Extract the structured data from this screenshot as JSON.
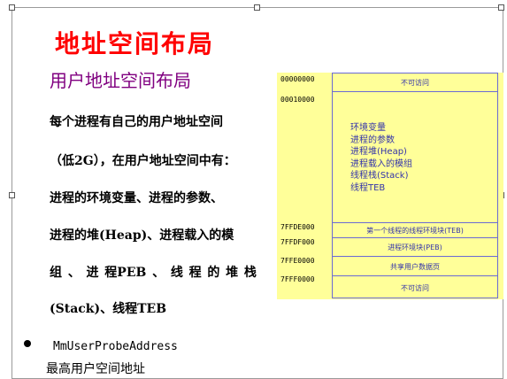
{
  "title": "地址空间布局",
  "subtitle": "用户地址空间布局",
  "body": {
    "line1": "每个进程有自己的用户地址空间",
    "line2": "（低2G），在用户地址空间中有：",
    "line3": "进程的环境变量、进程的参数、",
    "line4": "进程的堆(Heap)、进程载入的模",
    "line5_parts": [
      "组",
      "、",
      "进",
      "程PEB",
      "、",
      "线",
      "程",
      "的",
      "堆",
      "栈"
    ],
    "line6": "(Stack)、线程TEB"
  },
  "bullet": {
    "text": "MmUserProbeAddress",
    "sub": "最高用户空间地址"
  },
  "memory_map": {
    "addresses": [
      "00000000",
      "00010000",
      "7FFDE000",
      "7FFDF000",
      "7FFE0000",
      "7FFF0000"
    ],
    "rows": {
      "no_access_top": "不可访问",
      "first_thread_teb": "第一个线程的线程环境块(TEB)",
      "process_peb": "进程环境块(PEB)",
      "shared_user_data": "共享用户数据页",
      "no_access_bottom": "不可访问"
    },
    "user_region_items": [
      "环境变量",
      "进程的参数",
      "进程堆(Heap)",
      "进程载入的模组",
      "线程栈(Stack)",
      "线程TEB"
    ],
    "background_color": "#ffff99",
    "border_color": "#6a6ad4",
    "text_color": "#3333aa"
  },
  "colors": {
    "title": "#ff0000",
    "subtitle": "#800080"
  }
}
